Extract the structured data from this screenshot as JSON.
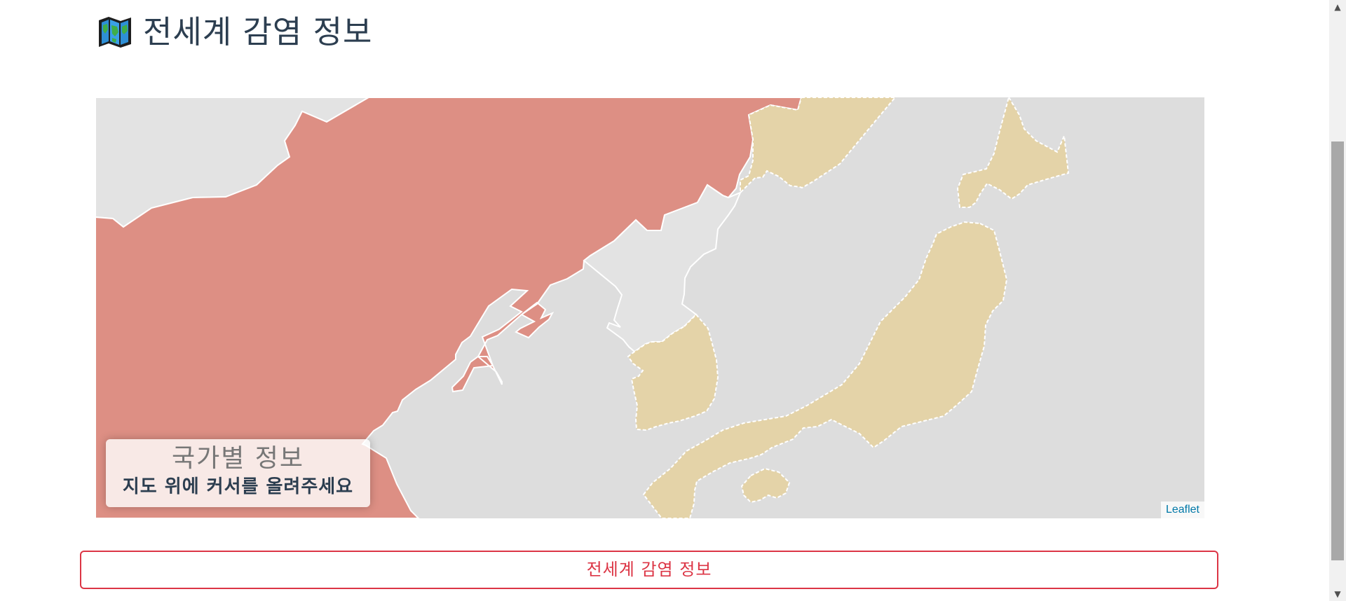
{
  "header": {
    "title": "전세계 감염 정보",
    "icon": "world-map-icon"
  },
  "map": {
    "info_box": {
      "title": "국가별 정보",
      "hint": "지도 위에 커서를 올려주세요"
    },
    "attribution": "Leaflet",
    "colors": {
      "high_infection": "#dd8f84",
      "medium_infection": "#e4d3a8",
      "no_data": "#e3e3e3",
      "sea": "#dddddd",
      "border": "#ffffff"
    }
  },
  "actions": {
    "global_button_label": "전세계 감염 정보"
  },
  "scrollbar": {
    "up_icon": "scroll-up-arrow-icon",
    "down_icon": "scroll-down-arrow-icon"
  }
}
